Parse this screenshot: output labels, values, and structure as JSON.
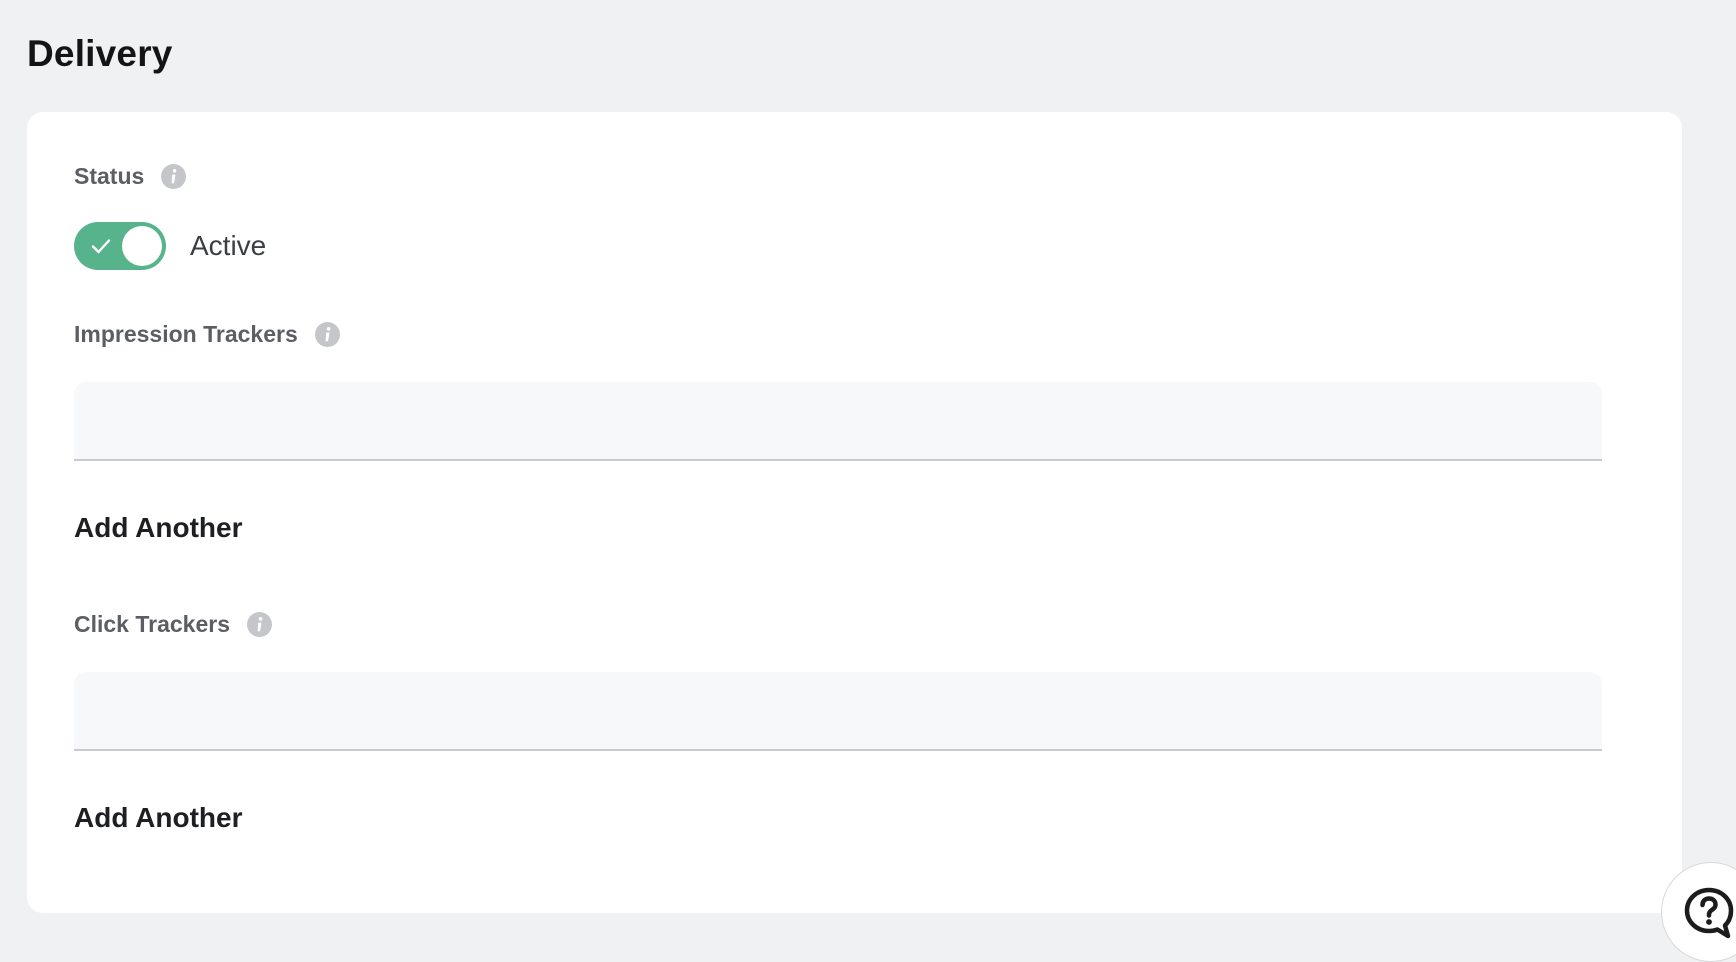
{
  "page": {
    "title": "Delivery"
  },
  "status": {
    "label": "Status",
    "toggle_state": "on",
    "toggle_label": "Active"
  },
  "impression_trackers": {
    "label": "Impression Trackers",
    "value": "",
    "placeholder": "",
    "add_another_label": "Add Another"
  },
  "click_trackers": {
    "label": "Click Trackers",
    "value": "",
    "placeholder": "",
    "add_another_label": "Add Another"
  },
  "icons": {
    "info": "info-icon",
    "check": "check-icon",
    "help": "help-question-icon"
  },
  "colors": {
    "background": "#f0f1f3",
    "card": "#ffffff",
    "toggle_on": "#56b38c",
    "label": "#5b5e63",
    "input_bg": "#f7f8f9"
  }
}
